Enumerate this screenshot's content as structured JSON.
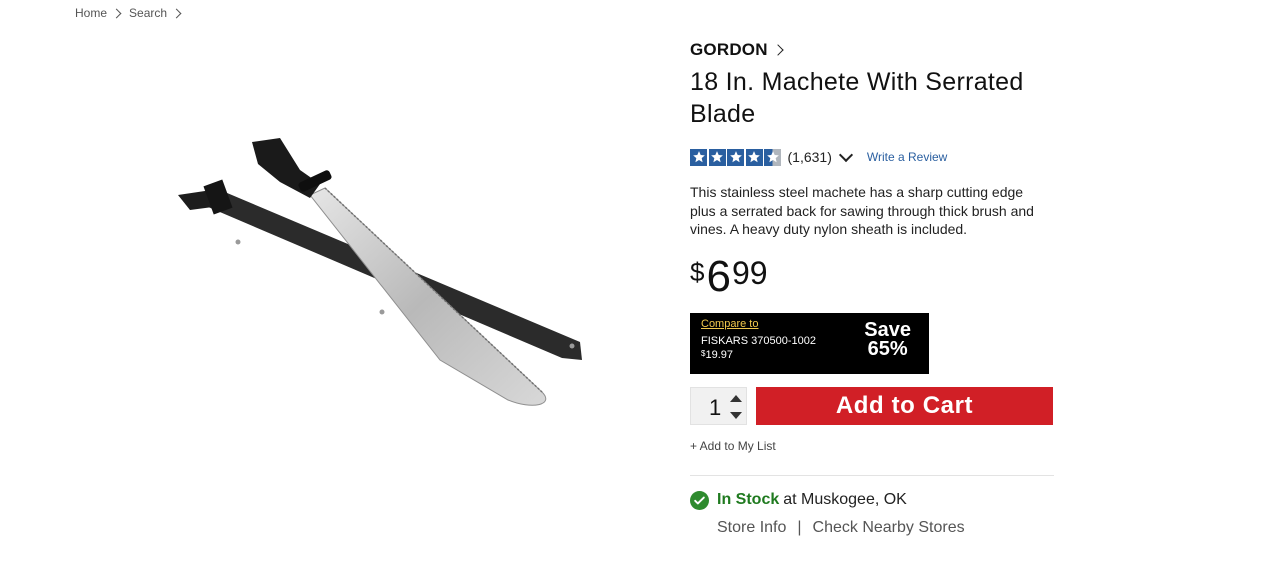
{
  "breadcrumb": {
    "items": [
      "Home",
      "Search"
    ]
  },
  "product": {
    "brand": "GORDON",
    "title": "18 In. Machete With Serrated Blade",
    "rating": {
      "stars": 4.5,
      "count": "(1,631)",
      "write_review": "Write a Review"
    },
    "description": "This stainless steel machete has a sharp cutting edge plus a serrated back for sawing through thick brush and vines. A heavy duty nylon sheath is included.",
    "price": {
      "currency": "$",
      "dollars": "6",
      "cents": "99"
    },
    "compare": {
      "label": "Compare to",
      "item": "FISKARS 370500-1002",
      "currency": "$",
      "price": "19.97",
      "save_label": "Save",
      "save_percent": "65%"
    },
    "quantity": "1",
    "add_to_cart": "Add to Cart",
    "add_to_list": "+ Add to My List",
    "stock": {
      "status": "In Stock",
      "location": "at Muskogee, OK",
      "store_info": "Store Info",
      "separator": "|",
      "nearby": "Check Nearby Stores"
    }
  },
  "colors": {
    "accent": "#d11f26",
    "rating_blue": "#2a5fa0",
    "stock_green": "#2e8b2e",
    "compare_gold": "#f2c94c"
  }
}
